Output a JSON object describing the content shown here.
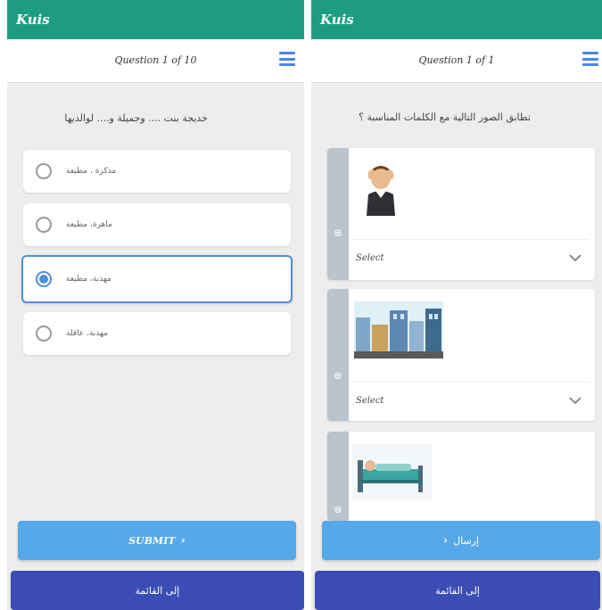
{
  "left": {
    "app_title": "Kuis",
    "question_counter": "Question 1 of 10",
    "question_text": "خديجة بنت .... وجميلة و.... لوالديها",
    "options": [
      {
        "label": "مذكرة ، مطيعة",
        "selected": false
      },
      {
        "label": "ماهرة، مطيعة",
        "selected": false
      },
      {
        "label": "مهذبة، مطيعة",
        "selected": true
      },
      {
        "label": "مهذبة، عاقلة",
        "selected": false
      }
    ],
    "submit_label": "SUBMIT",
    "back_label": "إلى القائمة"
  },
  "right": {
    "app_title": "Kuis",
    "question_counter": "Question 1 of 1",
    "question_text": "تطابق الصور التالية مع الكلمات المناسبة ؟",
    "cards": [
      {
        "image": "sad-person-holding-head",
        "select_placeholder": "Select"
      },
      {
        "image": "city-buildings",
        "select_placeholder": "Select"
      },
      {
        "image": "patient-in-hospital-bed",
        "select_placeholder": ""
      }
    ],
    "submit_label": "إرسال",
    "back_label": "إلى القائمة"
  },
  "colors": {
    "app_bar": "#1e9c83",
    "accent_blue": "#4f8fd8",
    "submit_button": "#56a9e8",
    "back_button": "#3b4db4",
    "menu_icon": "#4a86e8"
  }
}
